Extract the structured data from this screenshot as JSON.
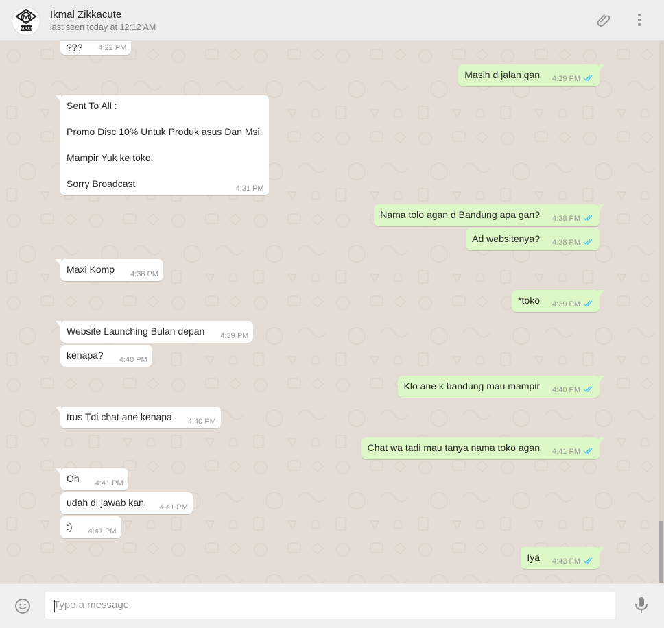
{
  "header": {
    "contact_name": "Ikmal Zikkacute",
    "status": "last seen today at 12:12 AM",
    "avatar_text": "MAXI",
    "attach_icon": "paperclip-icon",
    "menu_icon": "more-vertical-icon"
  },
  "colors": {
    "chat_bg": "#e5ddd5",
    "outgoing_bubble": "#dcf8c6",
    "incoming_bubble": "#ffffff",
    "read_ticks": "#4fc3f7",
    "header_bg": "#ededed"
  },
  "messages": [
    {
      "dir": "in",
      "text": "???",
      "time": "4:22 PM"
    },
    {
      "dir": "out",
      "text": "Masih d jalan gan",
      "time": "4:29 PM",
      "status": "read"
    },
    {
      "dir": "in",
      "lines": [
        "Sent To All :",
        "",
        "Promo Disc 10% Untuk Produk asus Dan Msi.",
        "",
        "Mampir Yuk ke toko.",
        "",
        "Sorry Broadcast"
      ],
      "time": "4:31 PM"
    },
    {
      "dir": "out",
      "text": "Nama tolo agan d Bandung apa gan?",
      "time": "4:38 PM",
      "status": "read"
    },
    {
      "dir": "out",
      "text": "Ad websitenya?",
      "time": "4:38 PM",
      "status": "read"
    },
    {
      "dir": "in",
      "text": "Maxi Komp",
      "time": "4:38 PM"
    },
    {
      "dir": "out",
      "text": "*toko",
      "time": "4:39 PM",
      "status": "read"
    },
    {
      "dir": "in",
      "text": "Website Launching Bulan depan",
      "time": "4:39 PM"
    },
    {
      "dir": "in",
      "text": "kenapa?",
      "time": "4:40 PM"
    },
    {
      "dir": "out",
      "text": "Klo ane k bandung mau mampir",
      "time": "4:40 PM",
      "status": "read"
    },
    {
      "dir": "in",
      "text": "trus Tdi chat ane kenapa",
      "time": "4:40 PM"
    },
    {
      "dir": "out",
      "text": "Chat wa tadi mau tanya nama toko agan",
      "time": "4:41 PM",
      "status": "read"
    },
    {
      "dir": "in",
      "text": "Oh",
      "time": "4:41 PM"
    },
    {
      "dir": "in",
      "text": "udah di jawab kan",
      "time": "4:41 PM"
    },
    {
      "dir": "in",
      "text": ":)",
      "time": "4:41 PM"
    },
    {
      "dir": "out",
      "text": "Iya",
      "time": "4:43 PM",
      "status": "read"
    }
  ],
  "composer": {
    "placeholder": "Type a message",
    "value": "",
    "emoji_icon": "smiley-icon",
    "mic_icon": "microphone-icon"
  }
}
